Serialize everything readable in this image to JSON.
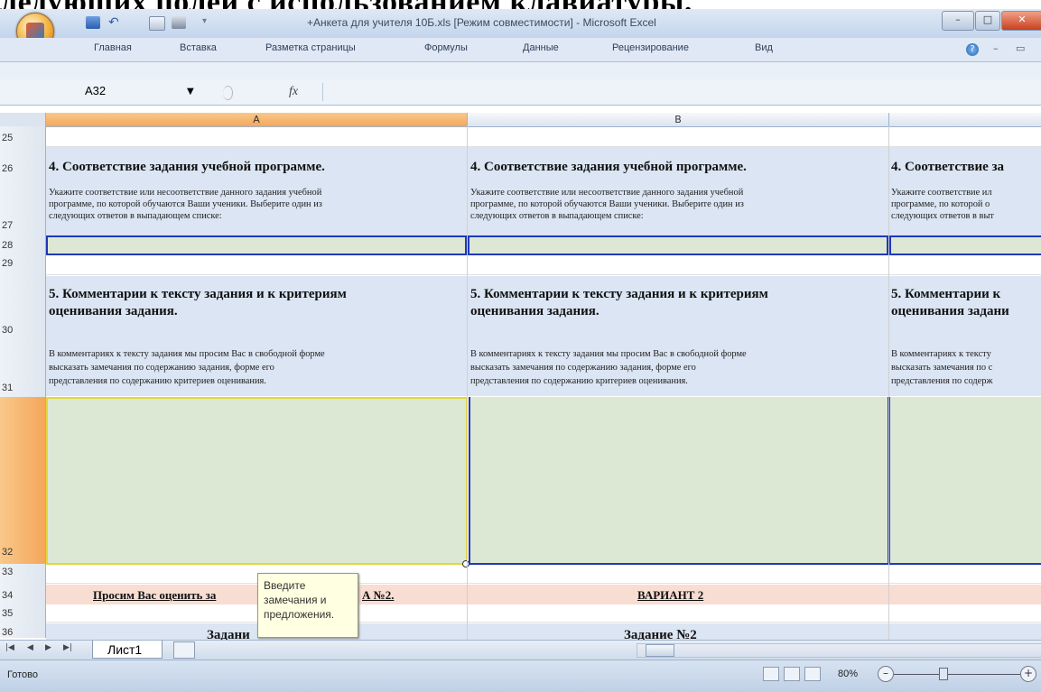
{
  "caption_top": "ледующих полей с использованием клавиатуры.",
  "window": {
    "title": "+Анкета для учителя 10Б.xls  [Режим совместимости]  -  Microsoft Excel",
    "min": "–",
    "max": "□",
    "close": "✕"
  },
  "ribbon_tabs": [
    "Главная",
    "Вставка",
    "Разметка страницы",
    "Формулы",
    "Данные",
    "Рецензирование",
    "Вид"
  ],
  "formula_bar": {
    "name_box": "A32",
    "fx": "fx",
    "value": ""
  },
  "columns": [
    "A",
    "B"
  ],
  "rows": [
    "25",
    "26",
    "27",
    "28",
    "29",
    "30",
    "31",
    "32",
    "33",
    "34",
    "35",
    "36"
  ],
  "section4": {
    "heading": "4. Соответствие задания учебной программе.",
    "heading_trunc": "4. Соответствие за",
    "text_lines": [
      "Укажите соответствие или несоответствие данного задания учебной",
      "программе, по которой обучаются Ваши ученики. Выберите один из",
      "следующих ответов в выпадающем списке:"
    ],
    "text_lines_trunc": [
      "Укажите соответствие ил",
      "программе, по которой о",
      "следующих ответов в выт"
    ]
  },
  "section5": {
    "heading_lines": [
      "5. Комментарии к тексту задания и к критериям",
      "оценивания задания."
    ],
    "heading_lines_trunc": [
      "5. Комментарии к",
      "оценивания задани"
    ],
    "text_lines": [
      "В комментариях к тексту задания мы просим Вас в свободной форме",
      "высказать замечания по содержанию задания, форме его",
      "представления по содержанию критериев оценивания."
    ],
    "text_lines_trunc": [
      "В комментариях к тексту",
      "высказать замечания по с",
      "представления по содерж"
    ]
  },
  "row34": {
    "a_left": "Просим Вас оценить за",
    "a_right": "А №2.",
    "b": "ВАРИАНТ 2"
  },
  "row36": {
    "a": "Задани",
    "b": "Задание №2"
  },
  "tooltip": {
    "lines": [
      "Введите",
      "замечания и",
      "предложения."
    ]
  },
  "sheet_tab": "Лист1",
  "status": {
    "ready": "Готово",
    "zoom": "80%"
  },
  "colors": {
    "accent_blue": "#2038b8",
    "cell_blue": "#dbe5f3",
    "cell_green": "#dde8d4",
    "cell_pink": "#f8ddd3",
    "selection_yellow": "#e2d83a"
  }
}
